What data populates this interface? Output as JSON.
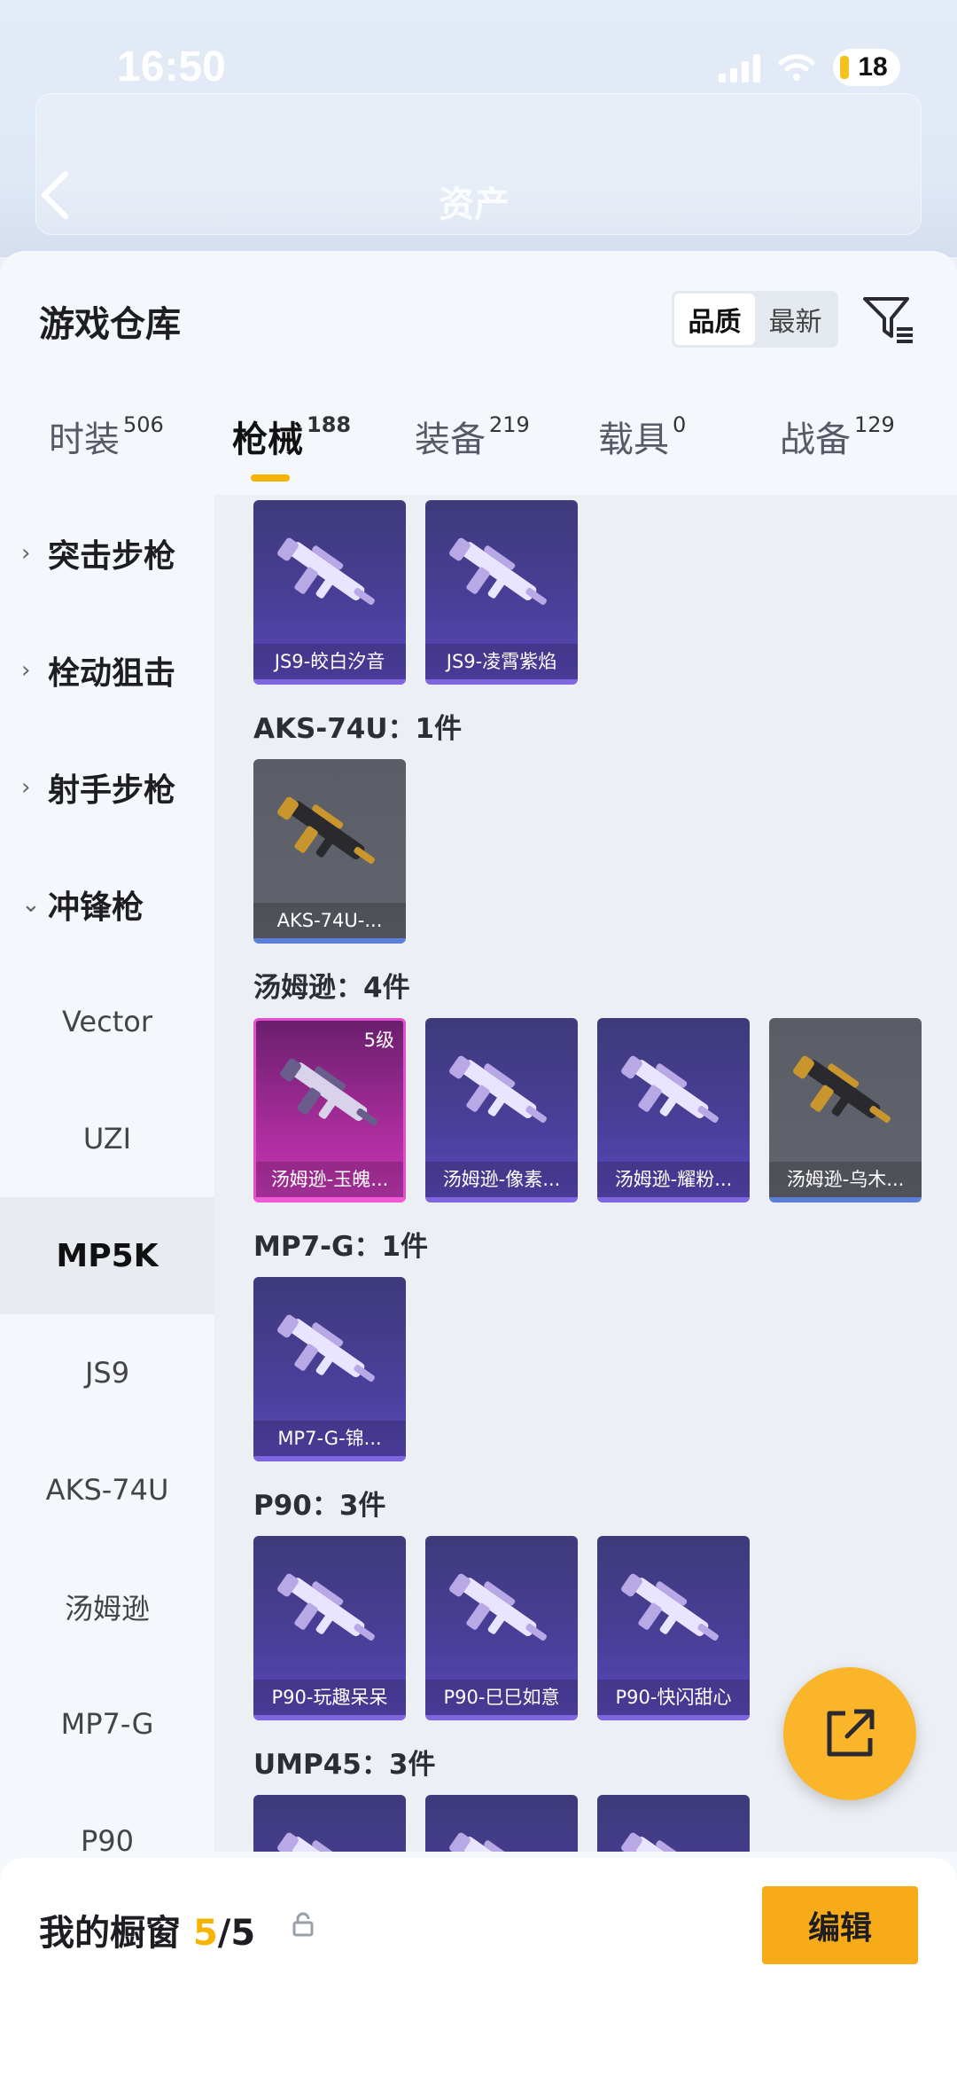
{
  "status_bar": {
    "time": "16:50",
    "battery": "18"
  },
  "backdrop": {
    "title": "资产"
  },
  "panel": {
    "title": "游戏仓库",
    "sort_options": [
      "品质",
      "最新"
    ],
    "tabs": [
      {
        "label": "时装",
        "count": "506"
      },
      {
        "label": "枪械",
        "count": "188"
      },
      {
        "label": "装备",
        "count": "219"
      },
      {
        "label": "载具",
        "count": "0"
      },
      {
        "label": "战备",
        "count": "129"
      }
    ]
  },
  "sidenav": {
    "categories": [
      {
        "label": "突击步枪",
        "chevron": ">"
      },
      {
        "label": "栓动狙击",
        "chevron": ">"
      },
      {
        "label": "射手步枪",
        "chevron": ">"
      },
      {
        "label": "冲锋枪",
        "chevron": "v"
      }
    ],
    "subitems": [
      "Vector",
      "UZI",
      "MP5K",
      "JS9",
      "AKS-74U",
      "汤姆逊",
      "MP7-G",
      "P90"
    ]
  },
  "content": {
    "sections": [
      {
        "label": "",
        "cards": [
          {
            "name": "JS9-皎白汐音",
            "rarity": "purple"
          },
          {
            "name": "JS9-凌霄紫焰",
            "rarity": "purple"
          }
        ]
      },
      {
        "label": "AKS-74U：1件",
        "cards": [
          {
            "name": "AKS-74U-...",
            "rarity": "gray"
          }
        ]
      },
      {
        "label": "汤姆逊：4件",
        "cards": [
          {
            "name": "汤姆逊-玉魄...",
            "rarity": "pink",
            "level": "5级"
          },
          {
            "name": "汤姆逊-像素...",
            "rarity": "purple"
          },
          {
            "name": "汤姆逊-耀粉...",
            "rarity": "purple"
          },
          {
            "name": "汤姆逊-乌木...",
            "rarity": "gray"
          }
        ]
      },
      {
        "label": "MP7-G：1件",
        "cards": [
          {
            "name": "MP7-G-锦...",
            "rarity": "purple"
          }
        ]
      },
      {
        "label": "P90：3件",
        "cards": [
          {
            "name": "P90-玩趣呆呆",
            "rarity": "purple"
          },
          {
            "name": "P90-巳巳如意",
            "rarity": "purple"
          },
          {
            "name": "P90-快闪甜心",
            "rarity": "purple"
          }
        ]
      },
      {
        "label": "UMP45：3件",
        "cards": [
          {
            "name": "",
            "rarity": "purple"
          },
          {
            "name": "",
            "rarity": "purple"
          },
          {
            "name": "",
            "rarity": "purple"
          }
        ]
      }
    ]
  },
  "showcase": {
    "title": "我的橱窗",
    "current": "5",
    "total": "/5",
    "edit_label": "编辑"
  }
}
